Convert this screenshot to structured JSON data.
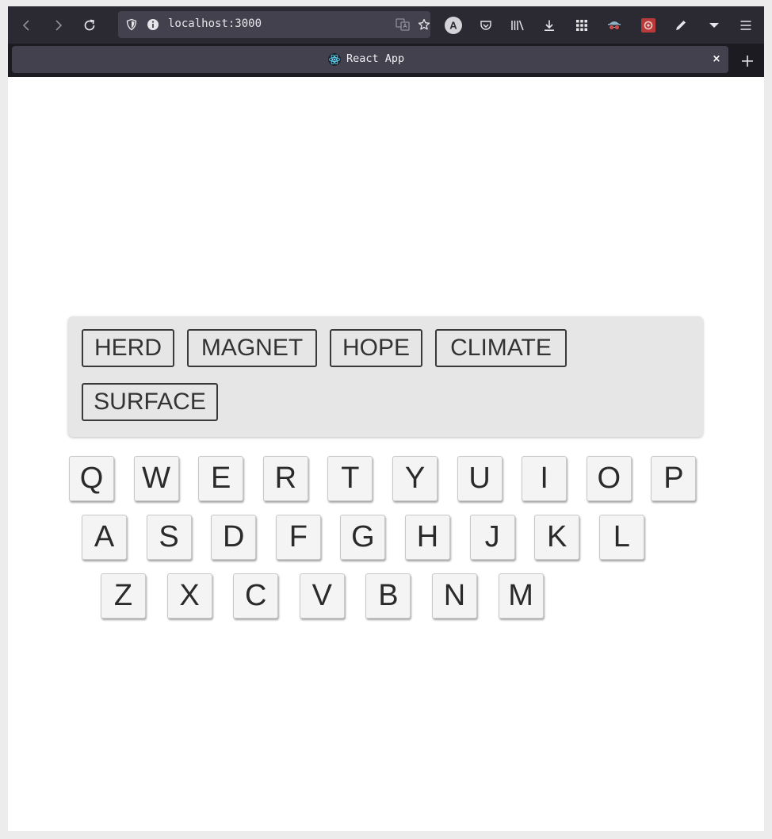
{
  "browser": {
    "url": "localhost:3000",
    "tab_title": "React App",
    "tab_close": "×"
  },
  "game": {
    "words": [
      "HERD",
      "MAGNET",
      "HOPE",
      "CLIMATE",
      "SURFACE"
    ],
    "keyboard": {
      "row1": [
        "Q",
        "W",
        "E",
        "R",
        "T",
        "Y",
        "U",
        "I",
        "O",
        "P"
      ],
      "row2": [
        "A",
        "S",
        "D",
        "F",
        "G",
        "H",
        "J",
        "K",
        "L"
      ],
      "row3": [
        "Z",
        "X",
        "C",
        "V",
        "B",
        "N",
        "M"
      ]
    }
  },
  "colors": {
    "chrome_bg": "#2b2a33",
    "urlbar_bg": "#42414d",
    "panel_bg": "#e6e6e6",
    "key_bg": "#f4f4f4"
  }
}
